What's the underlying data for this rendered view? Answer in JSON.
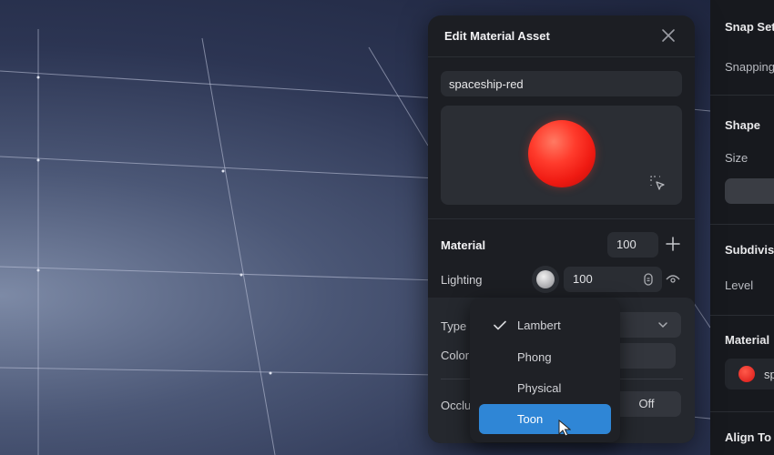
{
  "dialog": {
    "title": "Edit Material Asset",
    "name_value": "spaceship-red",
    "material": {
      "label": "Material",
      "value": "100"
    },
    "lighting": {
      "label": "Lighting",
      "value": "100"
    },
    "type": {
      "label": "Type"
    },
    "color": {
      "label": "Color"
    },
    "occlusion": {
      "label": "Occlu",
      "value": "Off"
    }
  },
  "dropdown": {
    "options": [
      {
        "label": "Lambert",
        "checked": true
      },
      {
        "label": "Phong"
      },
      {
        "label": "Physical"
      },
      {
        "label": "Toon",
        "highlighted": true
      }
    ]
  },
  "side_panel": {
    "snap_title": "Snap Set",
    "snapping_label": "Snapping",
    "shape_title": "Shape",
    "size_label": "Size",
    "subdivision_title": "Subdivisi",
    "level_label": "Level",
    "material_title": "Material",
    "material_name": "sp",
    "align_title": "Align To P"
  },
  "colors": {
    "accent": "#2f86d6",
    "material_red": "#ff2a1f",
    "panel_bg": "#1c1e23"
  }
}
